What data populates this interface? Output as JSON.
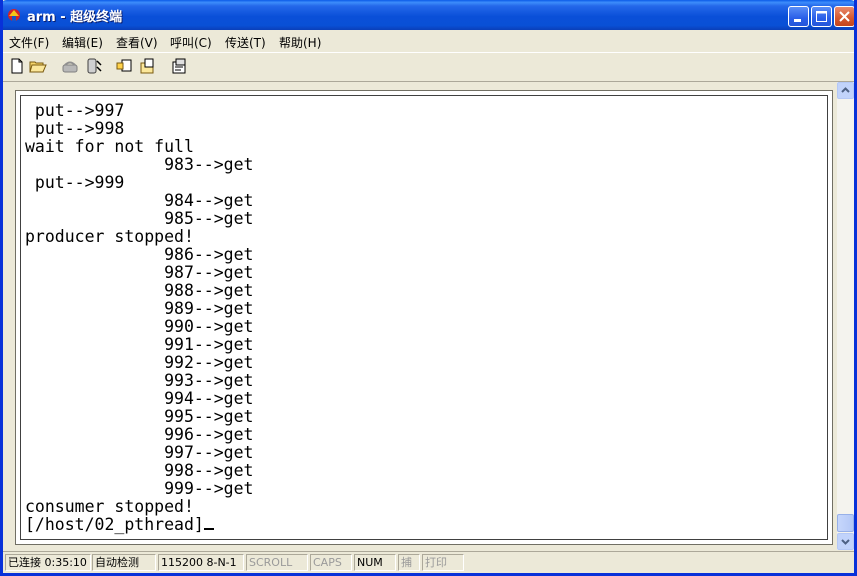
{
  "window": {
    "title": "arm - 超级终端"
  },
  "menu": [
    "文件(F)",
    "编辑(E)",
    "查看(V)",
    "呼叫(C)",
    "传送(T)",
    "帮助(H)"
  ],
  "toolbar": {
    "icons": [
      "new-document-icon",
      "open-folder-icon",
      "call-icon",
      "disconnect-icon",
      "send-icon",
      "receive-icon",
      "properties-icon"
    ]
  },
  "terminal": {
    "lines": [
      " put-->997",
      " put-->998",
      "wait for not full",
      "              983-->get",
      " put-->999",
      "              984-->get",
      "              985-->get",
      "producer stopped!",
      "              986-->get",
      "              987-->get",
      "              988-->get",
      "              989-->get",
      "              990-->get",
      "              991-->get",
      "              992-->get",
      "              993-->get",
      "              994-->get",
      "              995-->get",
      "              996-->get",
      "              997-->get",
      "              998-->get",
      "              999-->get",
      "consumer stopped!"
    ],
    "prompt": "[/host/02_pthread]"
  },
  "status": {
    "connection": "已连接 0:35:10",
    "detect": "自动检测",
    "baud": "115200 8-N-1",
    "scroll": "SCROLL",
    "caps": "CAPS",
    "num": "NUM",
    "capture": "捕",
    "print": "打印"
  }
}
